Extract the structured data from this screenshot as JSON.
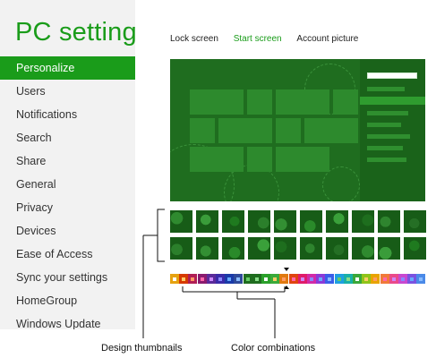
{
  "sidebar": {
    "app_title": "PC settings",
    "items": [
      {
        "label": "Personalize",
        "active": true
      },
      {
        "label": "Users"
      },
      {
        "label": "Notifications"
      },
      {
        "label": "Search"
      },
      {
        "label": "Share"
      },
      {
        "label": "General"
      },
      {
        "label": "Privacy"
      },
      {
        "label": "Devices"
      },
      {
        "label": "Ease of Access"
      },
      {
        "label": "Sync your settings"
      },
      {
        "label": "HomeGroup"
      },
      {
        "label": "Windows Update"
      }
    ]
  },
  "tabs": [
    {
      "label": "Lock screen",
      "active": false
    },
    {
      "label": "Start screen",
      "active": true
    },
    {
      "label": "Account picture",
      "active": false
    }
  ],
  "colors": {
    "accent": "#1a9c1a",
    "preview_background": "#1f6d1f",
    "swatches": [
      "#e6a210",
      "#d73a00",
      "#b01e55",
      "#8a1a6e",
      "#5a2a9a",
      "#3a2aa8",
      "#1a3aa8",
      "#2f4a9a",
      "#1f6d1f",
      "#1f6d1f",
      "#2aa02a",
      "#3aaa3a",
      "#e07a10",
      "#e0440f",
      "#e01b6a",
      "#d12aa8",
      "#8a3ad8",
      "#3a5ee8",
      "#1fa0e0",
      "#19b0a8",
      "#3aa83a",
      "#90c41a",
      "#e8a400",
      "#f07a3a",
      "#ea4a8a",
      "#c848d0",
      "#7a52e0",
      "#4a8ae8"
    ]
  },
  "thumbnails": {
    "row1": [
      "circles",
      "swirl",
      "flower",
      "leaf",
      "gears",
      "dots",
      "tiles",
      "plant",
      "spiral",
      "circuit"
    ],
    "row2": [
      "orbs",
      "spots",
      "vortex",
      "wave",
      "bird",
      "arrows",
      "bubbles",
      "floral",
      "stars",
      "blank"
    ]
  },
  "annotations": {
    "design": "Design thumbnails",
    "color": "Color combinations"
  }
}
